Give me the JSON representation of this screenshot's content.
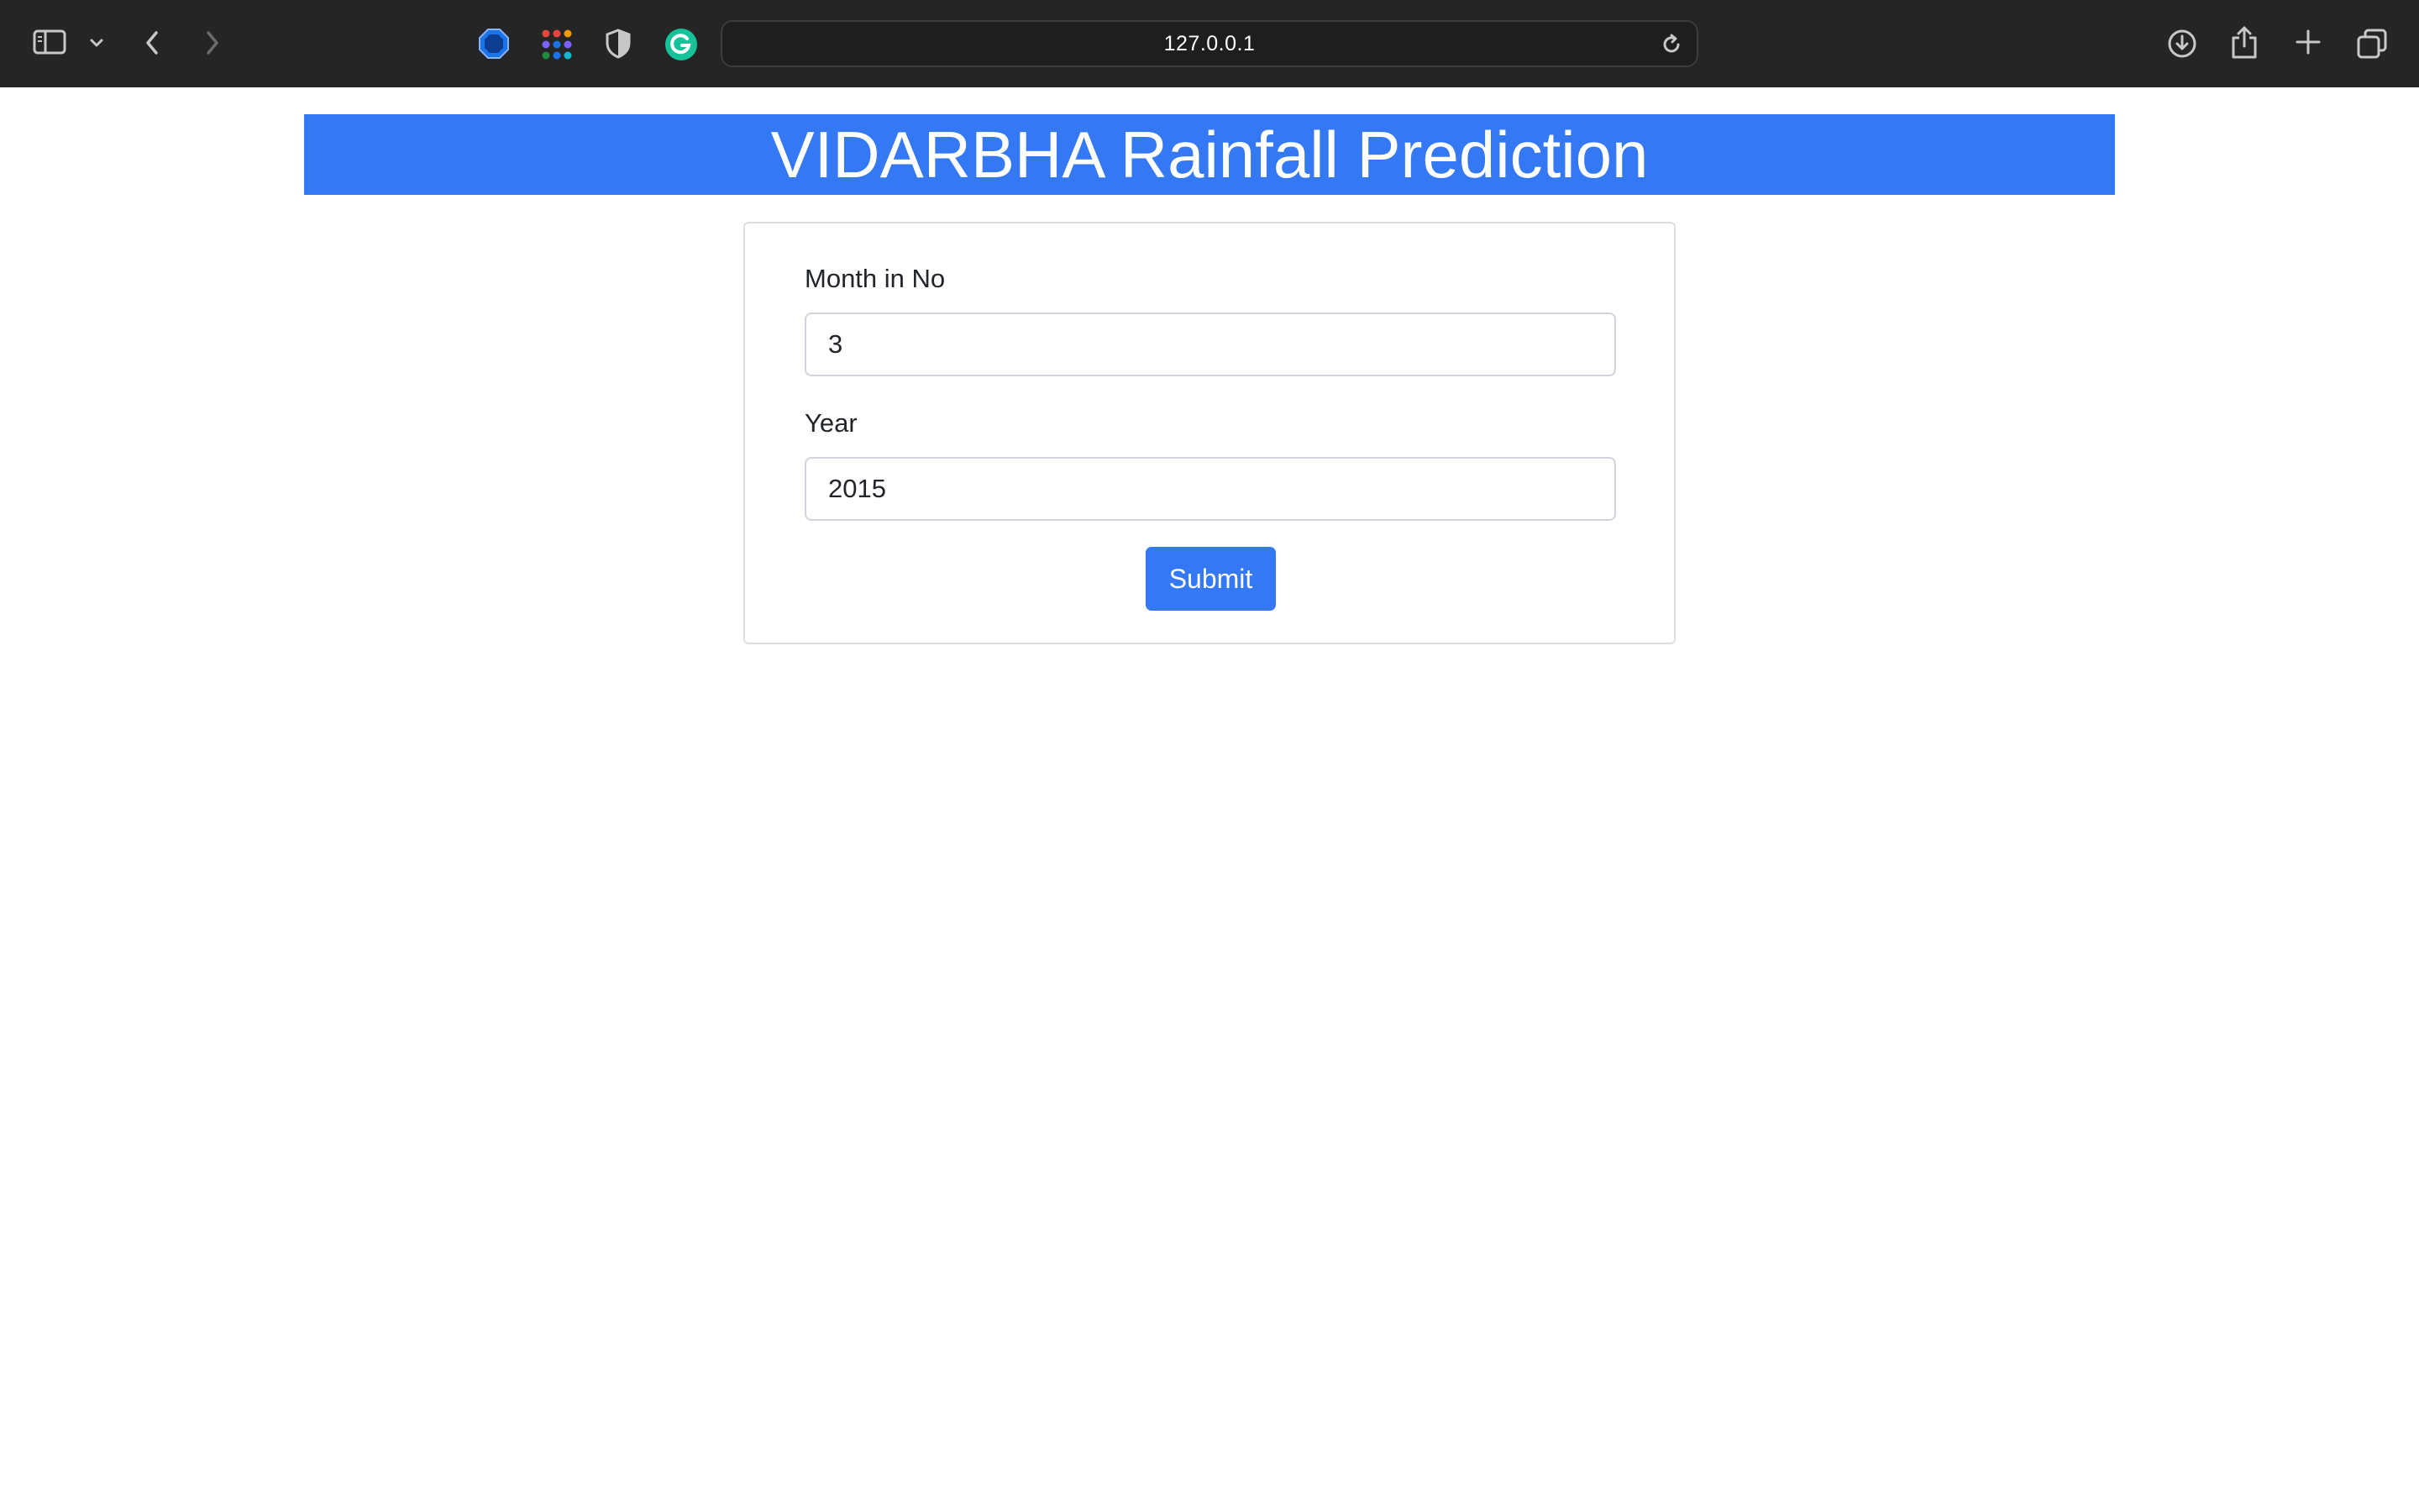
{
  "browser": {
    "url": "127.0.0.1",
    "icons": [
      "sidebar-icon",
      "chevron-down-icon",
      "back-icon",
      "forward-icon",
      "ublock-icon",
      "apps-grid-icon",
      "privacy-shield-icon",
      "grammarly-icon",
      "reload-icon",
      "download-icon",
      "share-icon",
      "new-tab-icon",
      "tab-overview-icon"
    ],
    "colors": {
      "toolbar_bg": "#252525",
      "urlbar_bg": "#1e1e1e"
    }
  },
  "page": {
    "title": "VIDARBHA Rainfall Prediction",
    "accent_color": "#3479f3",
    "form": {
      "month_label": "Month in No",
      "month_value": "3",
      "year_label": "Year",
      "year_value": "2015",
      "submit_label": "Submit"
    }
  }
}
